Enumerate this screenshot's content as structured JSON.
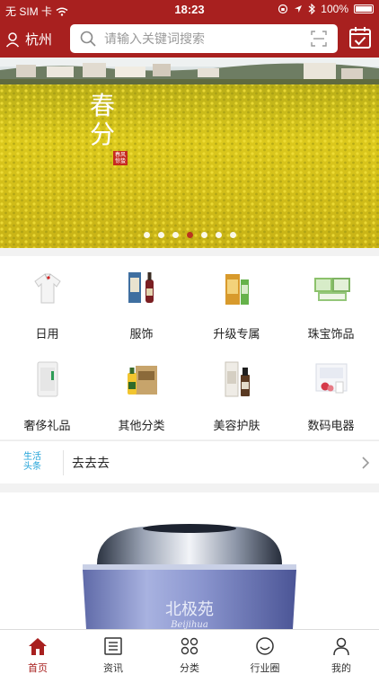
{
  "status_bar": {
    "carrier": "无 SIM 卡",
    "time": "18:23",
    "battery": "100%"
  },
  "header": {
    "city": "杭州",
    "search_placeholder": "请输入关键词搜索"
  },
  "banner": {
    "title_line1": "春",
    "title_line2": "分",
    "seal_text": "春风 惊蛰",
    "slide_count": 7,
    "active_slide_index": 4
  },
  "categories": [
    {
      "label": "日用",
      "icon": "shirt-icon"
    },
    {
      "label": "服饰",
      "icon": "bottles-icon"
    },
    {
      "label": "升级专属",
      "icon": "gift-box-icon"
    },
    {
      "label": "珠宝饰品",
      "icon": "packages-icon"
    },
    {
      "label": "奢侈礼品",
      "icon": "appliance-icon"
    },
    {
      "label": "其他分类",
      "icon": "oil-box-icon"
    },
    {
      "label": "美容护肤",
      "icon": "serum-icon"
    },
    {
      "label": "数码电器",
      "icon": "cosmetics-box-icon"
    }
  ],
  "headline": {
    "logo_line1": "生活",
    "logo_line2": "头条",
    "text": "去去去"
  },
  "product": {
    "brand_text": "北极苑",
    "brand_latin": "Beijihua"
  },
  "tabbar": {
    "items": [
      {
        "label": "首页",
        "active": true
      },
      {
        "label": "资讯",
        "active": false
      },
      {
        "label": "分类",
        "active": false
      },
      {
        "label": "行业圈",
        "active": false
      },
      {
        "label": "我的",
        "active": false
      }
    ]
  },
  "colors": {
    "brand_red": "#a8201f",
    "headline_blue": "#21a3d8"
  }
}
